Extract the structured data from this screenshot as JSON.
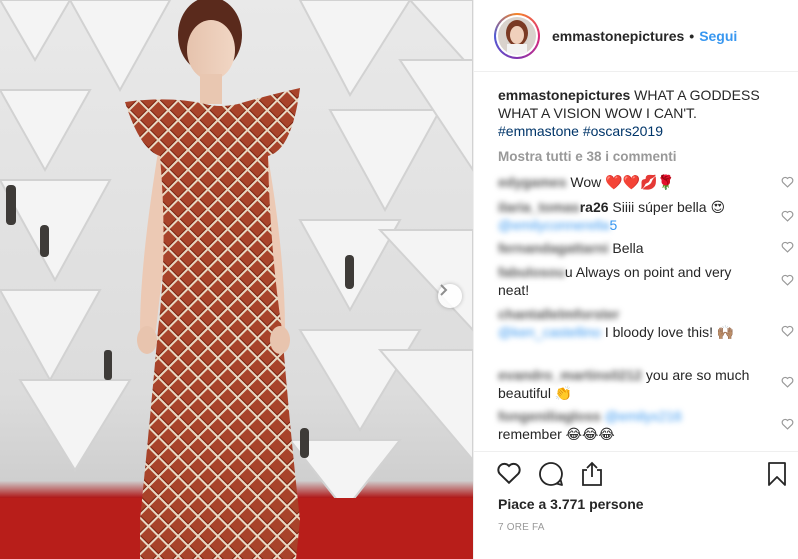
{
  "post": {
    "username": "emmastonepictures",
    "separator": "•",
    "follow_label": "Segui",
    "caption_text": "WHAT A GODDESS WHAT A VISION WOW I CAN'T.",
    "hashtags": [
      "#emmastone",
      "#oscars2019"
    ],
    "show_all_comments": "Mostra tutti e 38 i commenti",
    "likes_text": "Piace a 3.771 persone",
    "time_ago": "7 ORE FA"
  },
  "comments": [
    {
      "user": "edygames",
      "text": "Wow ❤️❤️💋🌹"
    },
    {
      "user": "ilaria_tomas",
      "user_suffix": "ra26",
      "text": "Siiii súper bella 😍",
      "mention": "@emilyconnerella",
      "mention_suffix": "5"
    },
    {
      "user": "fernandagattarni",
      "text": "Bella"
    },
    {
      "user": "fabulosou",
      "text": "u Always on point and very neat!"
    },
    {
      "user": "chantallelmforster",
      "mention": "@ken_castellino",
      "text": "I bloody love this! 🙌🏽"
    },
    {
      "user": "evandro_martins0212",
      "text": "you are so much beautiful 👏"
    },
    {
      "user": "fongeniliagloss",
      "mention": "@emilyx216",
      "text": "remember 😂😂😂"
    }
  ],
  "icons": {
    "like": "heart-outline-icon",
    "comment": "comment-bubble-icon",
    "share": "share-icon",
    "save": "bookmark-icon",
    "next": "chevron-right-icon"
  },
  "colors": {
    "link_blue": "#3897f0",
    "hashtag_blue": "#003569",
    "muted_gray": "#999999",
    "text": "#262626"
  }
}
